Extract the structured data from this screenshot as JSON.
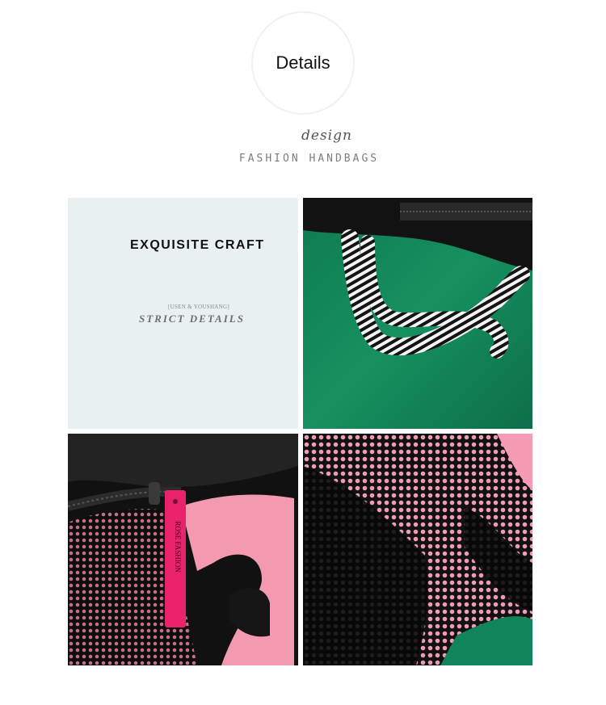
{
  "header": {
    "circle_title": "Details",
    "script_word": "design",
    "subtitle": "FASHION HANDBAGS"
  },
  "craft_panel": {
    "title": "EXQUISITE CRAFT",
    "small_text": "[USEN & YOUSHANG]",
    "tagline": "STRICT DETAILS"
  },
  "photos": {
    "handle_photo": "striped-handle-photo",
    "zipper_photo": "zipper-pull-photo",
    "mesh_photo": "mesh-pocket-photo",
    "zipper_tab_text": "ROSE FASHION"
  },
  "colors": {
    "green_bg": "#13855a",
    "pink": "#f39ab0",
    "zipper_pull": "#e8236b",
    "black": "#151515",
    "panel_bg": "#e8f0f1"
  }
}
